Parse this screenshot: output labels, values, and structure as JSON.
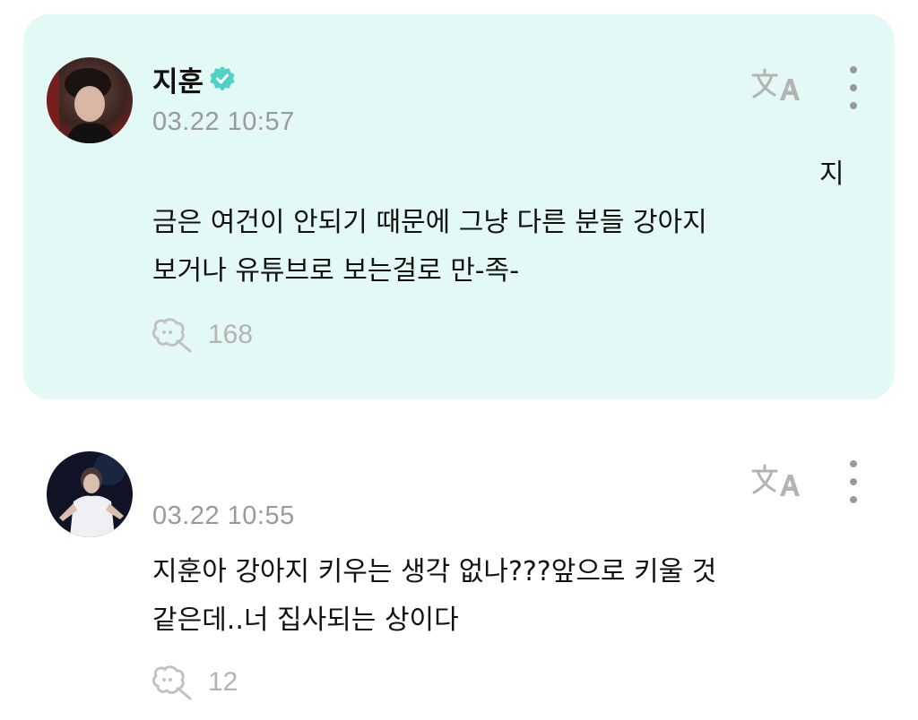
{
  "comments": [
    {
      "author": "지훈",
      "verified": true,
      "timestamp": "03.22 10:57",
      "lines": [
        "지",
        "금은 여건이 안되기 때문에 그냥 다른 분들 강아지",
        "보거나 유튜브로 보는걸로 만-족-"
      ],
      "reply_count": "168",
      "highlight_color": "#e3f9f6",
      "icons": [
        "translate-icon",
        "more-vertical-icon",
        "reply-icon",
        "verified-badge-icon"
      ]
    },
    {
      "author": "",
      "verified": false,
      "timestamp": "03.22 10:55",
      "lines": [
        "지훈아 강아지 키우는 생각 없나???앞으로 키울 것",
        "같은데..너 집사되는 상이다"
      ],
      "reply_count": "12",
      "icons": [
        "translate-icon",
        "more-vertical-icon",
        "reply-icon"
      ]
    }
  ],
  "colors": {
    "verified_badge": "#4fd1c5",
    "timestamp": "#9a9a9a",
    "icon_gray": "#b4b4b4"
  }
}
